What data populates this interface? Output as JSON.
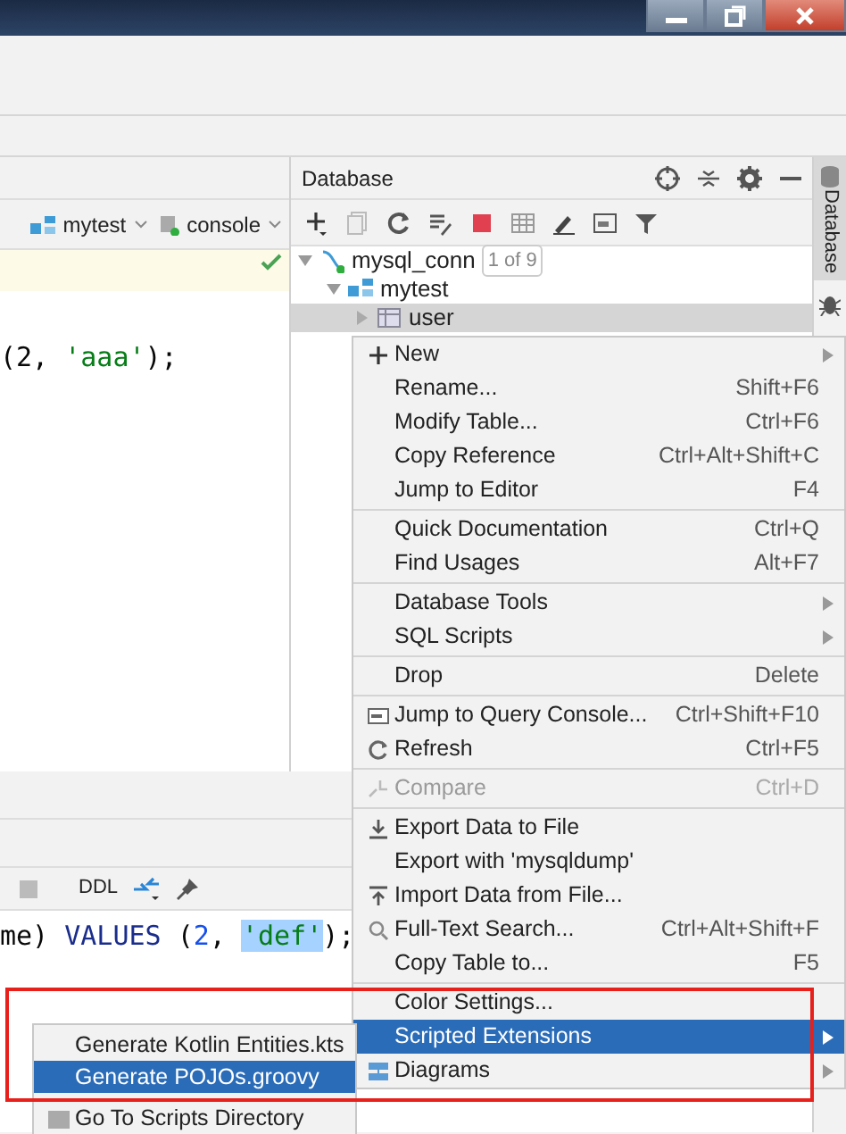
{
  "editor": {
    "schema": "mytest",
    "console": "console",
    "code_lines": [
      [
        {
          "text": "(2, ",
          "kind": "plain",
          "selected": false
        },
        {
          "text": "'aaa'",
          "kind": "string",
          "selected": false
        },
        {
          "text": ");",
          "kind": "plain",
          "selected": false
        }
      ]
    ]
  },
  "database_panel": {
    "title": "Database",
    "tree": [
      {
        "label": "mysql_conn",
        "badge": "1 of 9",
        "expanded": true,
        "selected": false,
        "children": [
          {
            "label": "mytest",
            "expanded": true,
            "selected": false,
            "children": [
              {
                "label": "user",
                "expanded": false,
                "selected": true
              }
            ]
          }
        ]
      }
    ]
  },
  "side_tab": "Database",
  "lower_panel": {
    "ddl": "DDL",
    "code_lines": [
      [
        {
          "text": "me) ",
          "kind": "plain",
          "selected": false
        },
        {
          "text": "VALUES",
          "kind": "keyword",
          "selected": false
        },
        {
          "text": " (",
          "kind": "plain",
          "selected": false
        },
        {
          "text": "2",
          "kind": "number",
          "selected": false
        },
        {
          "text": ", ",
          "kind": "plain",
          "selected": false
        },
        {
          "text": "'def'",
          "kind": "string",
          "selected": true
        },
        {
          "text": ");",
          "kind": "plain",
          "selected": false
        }
      ]
    ]
  },
  "context_menu": {
    "groups": [
      [
        {
          "label": "New",
          "submenu": true,
          "disabled": false,
          "selected": false
        },
        {
          "label": "Rename...",
          "shortcut": "Shift+F6",
          "submenu": false,
          "disabled": false,
          "selected": false
        },
        {
          "label": "Modify Table...",
          "shortcut": "Ctrl+F6",
          "submenu": false,
          "disabled": false,
          "selected": false
        },
        {
          "label": "Copy Reference",
          "shortcut": "Ctrl+Alt+Shift+C",
          "submenu": false,
          "disabled": false,
          "selected": false
        },
        {
          "label": "Jump to Editor",
          "shortcut": "F4",
          "submenu": false,
          "disabled": false,
          "selected": false
        }
      ],
      [
        {
          "label": "Quick Documentation",
          "shortcut": "Ctrl+Q",
          "submenu": false,
          "disabled": false,
          "selected": false
        },
        {
          "label": "Find Usages",
          "shortcut": "Alt+F7",
          "submenu": false,
          "disabled": false,
          "selected": false
        }
      ],
      [
        {
          "label": "Database Tools",
          "submenu": true,
          "disabled": false,
          "selected": false
        },
        {
          "label": "SQL Scripts",
          "submenu": true,
          "disabled": false,
          "selected": false
        }
      ],
      [
        {
          "label": "Drop",
          "shortcut": "Delete",
          "submenu": false,
          "disabled": false,
          "selected": false
        }
      ],
      [
        {
          "label": "Jump to Query Console...",
          "shortcut": "Ctrl+Shift+F10",
          "submenu": false,
          "disabled": false,
          "selected": false
        },
        {
          "label": "Refresh",
          "shortcut": "Ctrl+F5",
          "submenu": false,
          "disabled": false,
          "selected": false
        }
      ],
      [
        {
          "label": "Compare",
          "shortcut": "Ctrl+D",
          "submenu": false,
          "disabled": true,
          "selected": false
        }
      ],
      [
        {
          "label": "Export Data to File",
          "submenu": false,
          "disabled": false,
          "selected": false
        },
        {
          "label": "Export with 'mysqldump'",
          "submenu": false,
          "disabled": false,
          "selected": false
        },
        {
          "label": "Import Data from File...",
          "submenu": false,
          "disabled": false,
          "selected": false
        },
        {
          "label": "Full-Text Search...",
          "shortcut": "Ctrl+Alt+Shift+F",
          "submenu": false,
          "disabled": false,
          "selected": false
        },
        {
          "label": "Copy Table to...",
          "shortcut": "F5",
          "submenu": false,
          "disabled": false,
          "selected": false
        }
      ],
      [
        {
          "label": "Color Settings...",
          "submenu": false,
          "disabled": false,
          "selected": false
        },
        {
          "label": "Scripted Extensions",
          "submenu": true,
          "disabled": false,
          "selected": true
        },
        {
          "label": "Diagrams",
          "submenu": true,
          "disabled": false,
          "selected": false
        }
      ]
    ]
  },
  "submenu": {
    "groups": [
      [
        {
          "label": "Generate Kotlin Entities.kts",
          "selected": false
        },
        {
          "label": "Generate POJOs.groovy",
          "selected": true
        }
      ],
      [
        {
          "label": "Go To Scripts Directory",
          "selected": false
        }
      ]
    ]
  }
}
